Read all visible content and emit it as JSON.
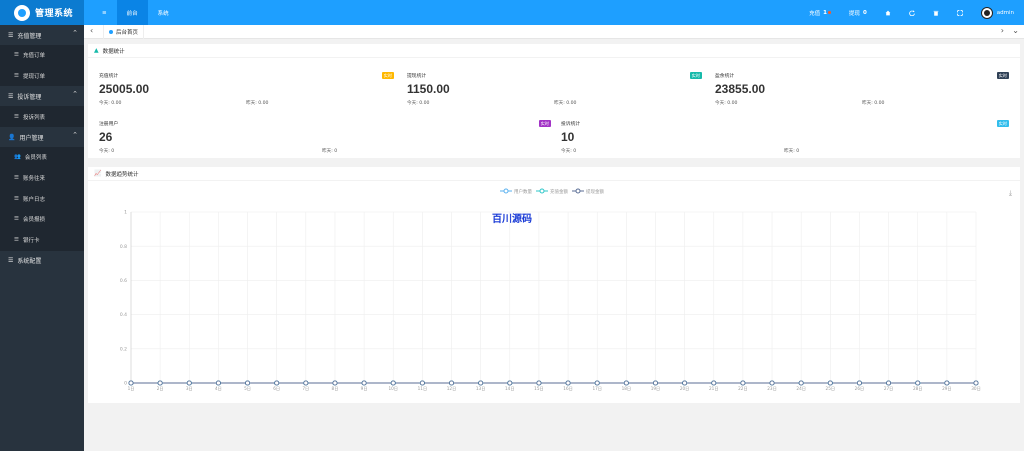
{
  "brand": {
    "name": "管理系统"
  },
  "topnav": {
    "menu_icon": "≡",
    "tabs": [
      {
        "label": "前台"
      },
      {
        "label": "系统"
      }
    ]
  },
  "topright": {
    "recharge_label": "充值",
    "recharge_count": "1",
    "withdraw_label": "提现",
    "withdraw_count": "0",
    "user_name": "admin"
  },
  "sidebar": {
    "groups": [
      {
        "label": "充值管理",
        "items": [
          {
            "label": "充值订单"
          },
          {
            "label": "提现订单"
          }
        ]
      },
      {
        "label": "投诉管理",
        "items": [
          {
            "label": "投诉列表"
          }
        ]
      },
      {
        "label": "用户管理",
        "items": [
          {
            "label": "会员列表"
          },
          {
            "label": "账务往来"
          },
          {
            "label": "账户日志"
          },
          {
            "label": "会员报损"
          },
          {
            "label": "银行卡"
          }
        ]
      },
      {
        "label": "系统配置",
        "items": []
      }
    ]
  },
  "breadcrumb": {
    "tab_label": "后台首页"
  },
  "stats_card": {
    "title": "数据统计",
    "today_label": "今天:",
    "yesterday_label": "昨天:",
    "items": [
      {
        "label": "充值统计",
        "value": "25005.00",
        "badge": "实时",
        "badge_color": "#ffb800",
        "today": "0.00",
        "yesterday": "0.00"
      },
      {
        "label": "提现统计",
        "value": "1150.00",
        "badge": "实时",
        "badge_color": "#16baaa",
        "today": "0.00",
        "yesterday": "0.00"
      },
      {
        "label": "盈余统计",
        "value": "23855.00",
        "badge": "实时",
        "badge_color": "#2f4056",
        "today": "0.00",
        "yesterday": "0.00"
      },
      {
        "label": "注册用户",
        "value": "26",
        "badge": "实时",
        "badge_color": "#a233c6",
        "today": "0",
        "yesterday": "0"
      },
      {
        "label": "投诉统计",
        "value": "10",
        "badge": "实时",
        "badge_color": "#31bdec",
        "today": "0",
        "yesterday": "0"
      }
    ]
  },
  "chart_card": {
    "title": "数据趋势统计",
    "watermark": "百川源码",
    "download_icon": "download-icon"
  },
  "chart_data": {
    "type": "line",
    "categories": [
      "1日",
      "2日",
      "3日",
      "4日",
      "5日",
      "6日",
      "7日",
      "8日",
      "9日",
      "10日",
      "11日",
      "12日",
      "13日",
      "14日",
      "15日",
      "16日",
      "17日",
      "18日",
      "19日",
      "20日",
      "21日",
      "22日",
      "23日",
      "24日",
      "25日",
      "26日",
      "27日",
      "28日",
      "29日",
      "30日"
    ],
    "series": [
      {
        "name": "用户数量",
        "color": "#5ab1ef",
        "values": [
          0,
          0,
          0,
          0,
          0,
          0,
          0,
          0,
          0,
          0,
          0,
          0,
          0,
          0,
          0,
          0,
          0,
          0,
          0,
          0,
          0,
          0,
          0,
          0,
          0,
          0,
          0,
          0,
          0,
          0
        ]
      },
      {
        "name": "充值金额",
        "color": "#2ec7c9",
        "values": [
          0,
          0,
          0,
          0,
          0,
          0,
          0,
          0,
          0,
          0,
          0,
          0,
          0,
          0,
          0,
          0,
          0,
          0,
          0,
          0,
          0,
          0,
          0,
          0,
          0,
          0,
          0,
          0,
          0,
          0
        ]
      },
      {
        "name": "提现金额",
        "color": "#5b6e96",
        "values": [
          0,
          0,
          0,
          0,
          0,
          0,
          0,
          0,
          0,
          0,
          0,
          0,
          0,
          0,
          0,
          0,
          0,
          0,
          0,
          0,
          0,
          0,
          0,
          0,
          0,
          0,
          0,
          0,
          0,
          0
        ]
      }
    ],
    "yticks": [
      "0",
      "0.2",
      "0.4",
      "0.6",
      "0.8",
      "1"
    ],
    "ylim": [
      0,
      1
    ],
    "grid": true,
    "legend_position": "top-center"
  }
}
